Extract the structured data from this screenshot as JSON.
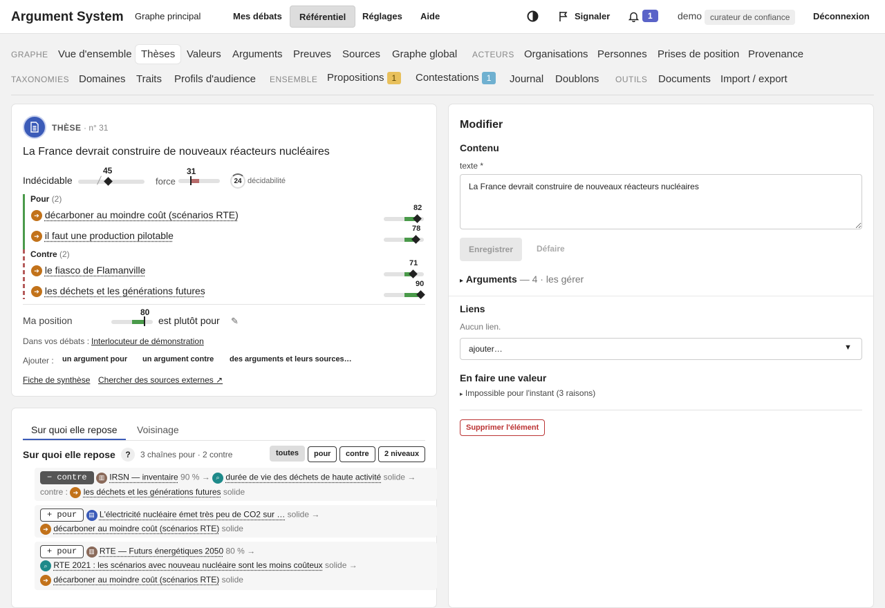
{
  "topbar": {
    "brand": "Argument System",
    "graph_link": "Graphe principal",
    "nav": [
      "Mes débats",
      "Référentiel",
      "Réglages",
      "Aide"
    ],
    "report": "Signaler",
    "notif_count": "1",
    "user": "demo",
    "role": "curateur de confiance",
    "logout": "Déconnexion"
  },
  "nav": {
    "row1": {
      "sec_graph": "GRAPHE",
      "graph": [
        "Vue d'ensemble",
        "Thèses",
        "Valeurs",
        "Arguments",
        "Preuves",
        "Sources",
        "Graphe global"
      ],
      "sec_actors": "ACTEURS",
      "actors": [
        "Organisations",
        "Personnes",
        "Prises de position",
        "Provenance"
      ]
    },
    "row2": {
      "sec_tax": "TAXONOMIES",
      "tax": [
        "Domaines",
        "Traits",
        "Profils d'audience"
      ],
      "sec_set": "ENSEMBLE",
      "propositions": "Propositions",
      "propositions_count": "1",
      "contestations": "Contestations",
      "contestations_count": "1",
      "set_rest": [
        "Journal",
        "Doublons"
      ],
      "sec_tools": "OUTILS",
      "tools": [
        "Documents",
        "Import / export"
      ]
    }
  },
  "thesis": {
    "kind": "THÈSE",
    "number": "· n° 31",
    "title": "La France devrait construire de nouveaux réacteurs nucléaires",
    "status": "Indécidable",
    "status_value": "45",
    "force_label": "force",
    "force_value": "31",
    "decid_value": "24",
    "decid_label": "décidabilité",
    "pour_label": "Pour",
    "pour_count": "(2)",
    "pour": [
      {
        "text": "décarboner au moindre coût (scénarios RTE)",
        "score": "82"
      },
      {
        "text": "il faut une production pilotable",
        "score": "78"
      }
    ],
    "contre_label": "Contre",
    "contre_count": "(2)",
    "contre": [
      {
        "text": "le fiasco de Flamanville",
        "score": "71"
      },
      {
        "text": "les déchets et les générations futures",
        "score": "90"
      }
    ],
    "my_position_label": "Ma position",
    "my_position_value": "80",
    "my_position_text": "est plutôt pour",
    "in_debates_label": "Dans vos débats :",
    "in_debates_link": "Interlocuteur de démonstration",
    "add_label": "Ajouter :",
    "add_buttons": [
      "un argument pour",
      "un argument contre",
      "des arguments et leurs sources…"
    ],
    "links": [
      "Fiche de synthèse",
      "Chercher des sources externes ↗"
    ]
  },
  "repose": {
    "tabs": [
      "Sur quoi elle repose",
      "Voisinage"
    ],
    "title": "Sur quoi elle repose",
    "help": "?",
    "summary": "3 chaînes pour · 2 contre",
    "filters": [
      "toutes",
      "pour",
      "contre",
      "2 niveaux"
    ],
    "chains": [
      {
        "btn": "− contre",
        "a_src": "IRSN — inventaire",
        "a_pct": "90 %",
        "b_text": "durée de vie des déchets de haute activité",
        "b_state": "solide",
        "prefix": "contre :",
        "c_text": "les déchets et les générations futures",
        "c_state": "solide"
      },
      {
        "btn": "+ pour",
        "a_text": "L'électricité nucléaire émet très peu de CO2 sur …",
        "a_state": "solide",
        "c_text": "décarboner au moindre coût (scénarios RTE)",
        "c_state": "solide"
      },
      {
        "btn": "+ pour",
        "a_src": "RTE — Futurs énergétiques 2050",
        "a_pct": "80 %",
        "b_text": "RTE 2021 : les scénarios avec nouveau nucléaire sont les moins coûteux",
        "b_state": "solide",
        "c_text": "décarboner au moindre coût (scénarios RTE)",
        "c_state": "solide"
      }
    ]
  },
  "edit": {
    "title": "Modifier",
    "content_heading": "Contenu",
    "text_label": "texte *",
    "text_value": "La France devrait construire de nouveaux réacteurs nucléaires",
    "save": "Enregistrer",
    "undo": "Défaire",
    "arguments_label": "Arguments",
    "arguments_meta": "— 4 · les gérer",
    "links_heading": "Liens",
    "no_links": "Aucun lien.",
    "add_select": "ajouter…",
    "value_heading": "En faire une valeur",
    "impossible": "Impossible pour l'instant (3 raisons)",
    "delete": "Supprimer l'élément"
  }
}
